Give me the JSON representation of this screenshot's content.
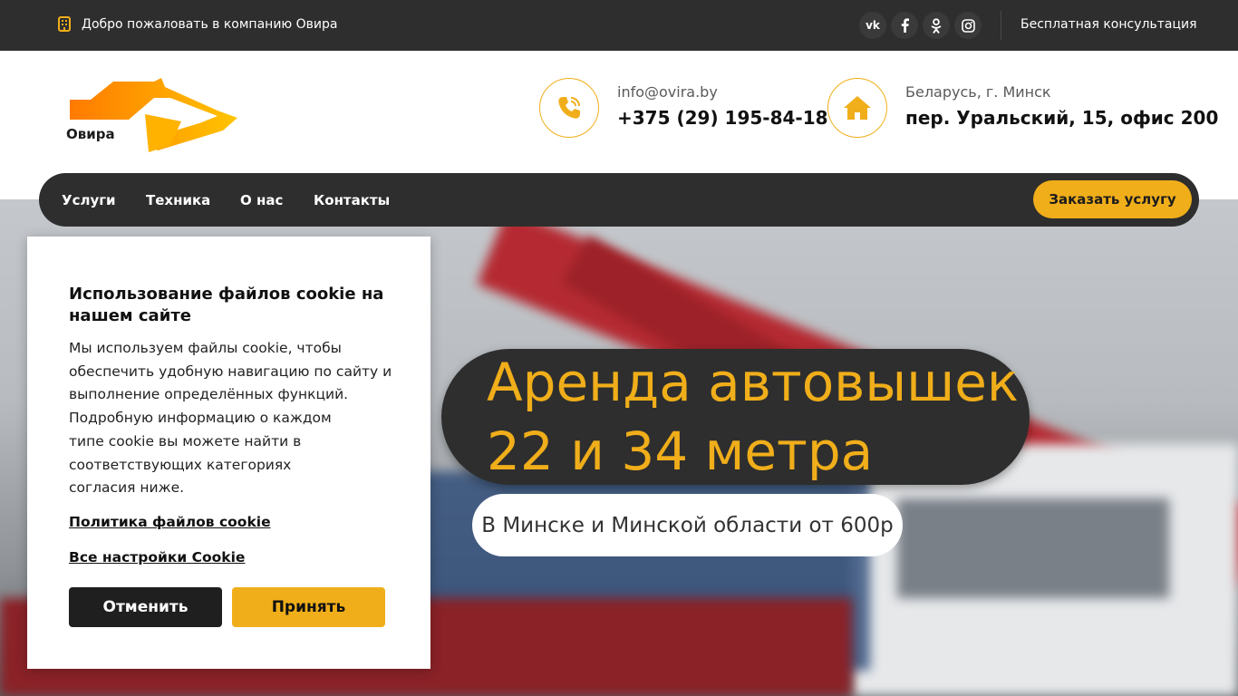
{
  "topbar": {
    "welcome": "Добро пожаловать в компанию Овира",
    "social": [
      {
        "icon": "vk-icon",
        "glyph": "vk"
      },
      {
        "icon": "facebook-icon",
        "glyph": "f"
      },
      {
        "icon": "odnoklassniki-icon",
        "glyph": "ok"
      },
      {
        "icon": "instagram-icon",
        "glyph": "ig"
      }
    ],
    "consult_link": "Бесплатная консультация"
  },
  "header": {
    "logo_text": "Овира",
    "email": "info@ovira.by",
    "phone": "+375 (29) 195-84-18",
    "address_top": "Беларусь, г. Минск",
    "address_main": "пер. Уральский, 15, офис 200"
  },
  "nav": {
    "items": [
      "Услуги",
      "Техника",
      "О нас",
      "Контакты"
    ],
    "cta": "Заказать услугу"
  },
  "hero": {
    "title_line1": "Аренда автовышек",
    "title_line2": "22 и 34 метра",
    "subtitle": "В Минске и Минской области от 600р"
  },
  "cookie": {
    "title": "Использование файлов cookie на нашем сайте",
    "text_lines": [
      "Мы используем файлы cookie, чтобы",
      "обеспечить удобную навигацию по сайту и",
      "выполнение определённых функций.",
      "Подробную информацию о каждом",
      "типе cookie вы можете найти в",
      "соответствующих категориях",
      "согласия ниже."
    ],
    "policy_link": "Политика файлов cookie",
    "settings_link": "Все настройки Cookie",
    "cancel": "Отменить",
    "accept": "Принять"
  },
  "colors": {
    "accent": "#f0ae1a",
    "dark": "#2e2e2e",
    "logo_gradient_start": "#ff7a00",
    "logo_gradient_end": "#ffc400"
  }
}
